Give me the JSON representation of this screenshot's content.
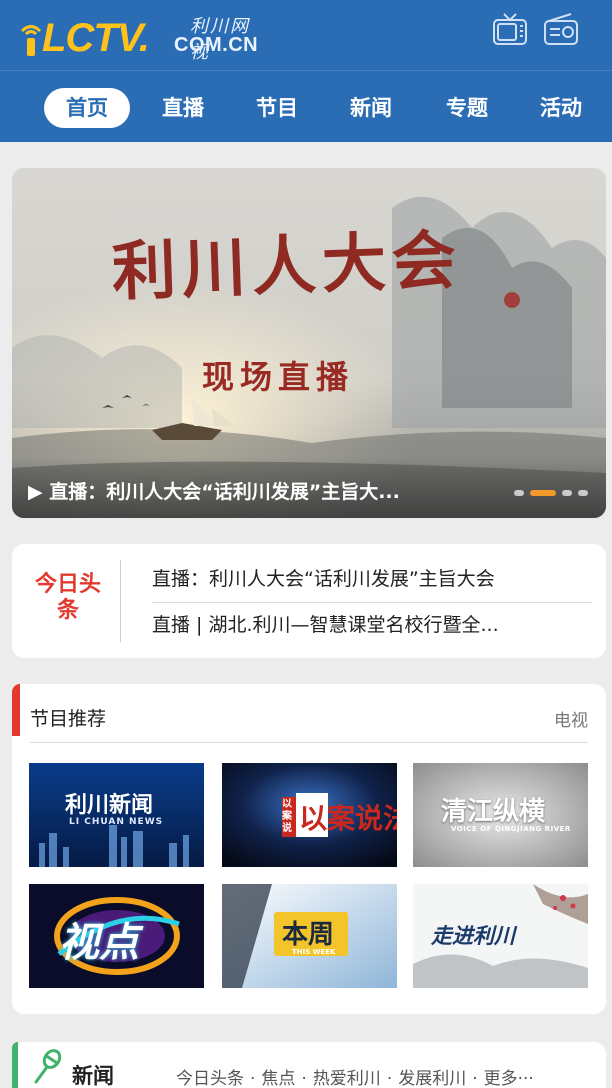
{
  "header": {
    "logo_main": "LCTV.",
    "logo_domain": "COM.CN",
    "logo_cn": "利川网视",
    "icons": [
      "tv-icon",
      "radio-icon"
    ],
    "brand_color": "#2a6db5",
    "accent_color": "#ffc21a"
  },
  "nav": {
    "items": [
      {
        "label": "首页",
        "active": true
      },
      {
        "label": "直播"
      },
      {
        "label": "节目"
      },
      {
        "label": "新闻"
      },
      {
        "label": "专题"
      },
      {
        "label": "活动"
      }
    ]
  },
  "banner": {
    "title": "利川人大会",
    "subtitle": "现场直播",
    "caption": "▶ 直播：利川人大会“话利川发展”主旨大...",
    "slide_count": 4,
    "active_slide": 2
  },
  "headlines": {
    "badge": "今日头条",
    "items": [
      "直播：利川人大会“话利川发展”主旨大会",
      "直播 | 湖北.利川—智慧课堂名校行暨全..."
    ]
  },
  "programs": {
    "title": "节目推荐",
    "more": "电视",
    "items": [
      {
        "label": "利川新闻",
        "sub": "LI CHUAN NEWS"
      },
      {
        "label": "以案说法"
      },
      {
        "label": "清江纵横",
        "sub": "VOICE OF QINGJIANG RIVER"
      },
      {
        "label": "视点"
      },
      {
        "label": "本周",
        "sub": "THIS WEEK"
      },
      {
        "label": "走进利川"
      }
    ]
  },
  "news": {
    "title": "新闻",
    "links": [
      "今日头条",
      "焦点",
      "热爱利川",
      "发展利川",
      "更多···"
    ]
  }
}
